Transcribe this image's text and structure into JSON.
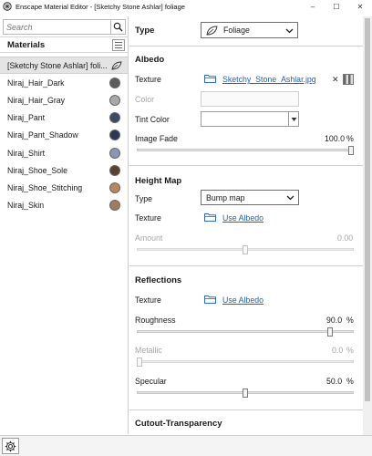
{
  "window": {
    "title": "Enscape Material Editor - [Sketchy Stone Ashlar] foliage",
    "controls": {
      "minimize": "–",
      "maximize": "☐",
      "close": "✕"
    }
  },
  "sidebar": {
    "search": {
      "placeholder": "Search",
      "value": ""
    },
    "header": "Materials",
    "items": [
      {
        "label": "[Sketchy Stone Ashlar] foli...",
        "swatch": "leaf-icon",
        "selected": true
      },
      {
        "label": "Niraj_Hair_Dark",
        "swatch": "#5c5c5c"
      },
      {
        "label": "Niraj_Hair_Gray",
        "swatch": "#a8a8a8"
      },
      {
        "label": "Niraj_Pant",
        "swatch": "#3c4a6a"
      },
      {
        "label": "Niraj_Pant_Shadow",
        "swatch": "#2c3656"
      },
      {
        "label": "Niraj_Shirt",
        "swatch": "#8b95b7"
      },
      {
        "label": "Niraj_Shoe_Sole",
        "swatch": "#5a4230"
      },
      {
        "label": "Niraj_Shoe_Stitching",
        "swatch": "#b9875a"
      },
      {
        "label": "Niraj_Skin",
        "swatch": "#a07b5e"
      }
    ]
  },
  "type": {
    "label": "Type",
    "value": "Foliage"
  },
  "albedo": {
    "title": "Albedo",
    "texture_label": "Texture",
    "texture_file": "Sketchy_Stone_Ashlar.jpg",
    "clear": "✕",
    "color_label": "Color",
    "tint_label": "Tint Color",
    "fade_label": "Image Fade",
    "fade_value": "100.0",
    "fade_fraction": 1.0,
    "unit": "%"
  },
  "heightmap": {
    "title": "Height Map",
    "type_label": "Type",
    "type_value": "Bump map",
    "texture_label": "Texture",
    "texture_link": "Use Albedo",
    "amount_label": "Amount",
    "amount_value": "0.00",
    "amount_fraction": 0.5
  },
  "reflections": {
    "title": "Reflections",
    "texture_label": "Texture",
    "texture_link": "Use Albedo",
    "roughness_label": "Roughness",
    "roughness_value": "90.0",
    "roughness_fraction": 0.9,
    "metallic_label": "Metallic",
    "metallic_value": "0.0",
    "metallic_fraction": 0.0,
    "specular_label": "Specular",
    "specular_value": "50.0",
    "specular_fraction": 0.5,
    "unit": "%"
  },
  "cutout": {
    "title": "Cutout-Transparency"
  },
  "colors": {
    "link": "#1f64b9",
    "folder": "#2f6fb8"
  }
}
